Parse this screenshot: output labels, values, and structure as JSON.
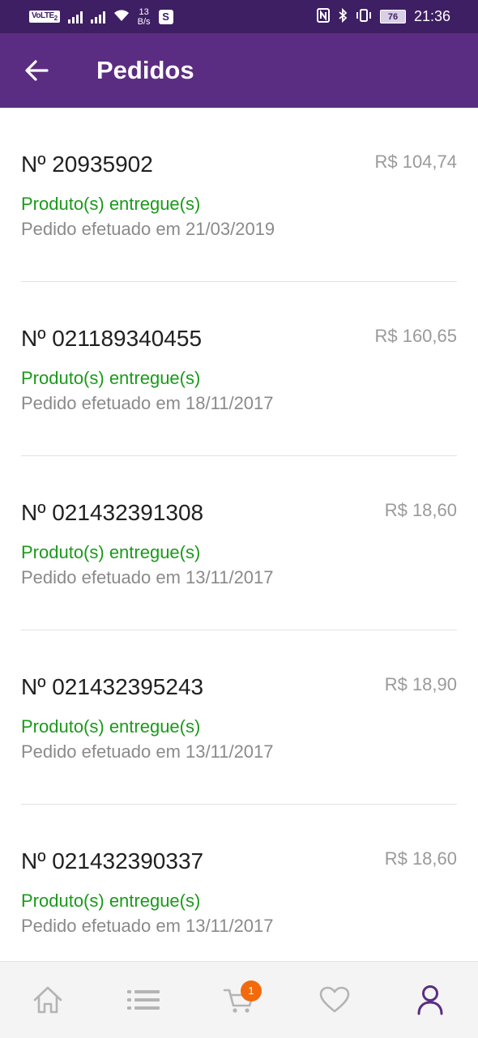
{
  "status_bar": {
    "volte": "VoLTE",
    "volte_sim": "2",
    "net_speed_value": "13",
    "net_speed_unit": "B/s",
    "app_badge": "S",
    "battery": "76",
    "time": "21:36"
  },
  "header": {
    "title": "Pedidos"
  },
  "orders": [
    {
      "number": "Nº 20935902",
      "price": "R$ 104,74",
      "status": "Produto(s) entregue(s)",
      "date": "Pedido efetuado em 21/03/2019"
    },
    {
      "number": "Nº 021189340455",
      "price": "R$ 160,65",
      "status": "Produto(s) entregue(s)",
      "date": "Pedido efetuado em 18/11/2017"
    },
    {
      "number": "Nº 021432391308",
      "price": "R$ 18,60",
      "status": "Produto(s) entregue(s)",
      "date": "Pedido efetuado em 13/11/2017"
    },
    {
      "number": "Nº 021432395243",
      "price": "R$ 18,90",
      "status": "Produto(s) entregue(s)",
      "date": "Pedido efetuado em 13/11/2017"
    },
    {
      "number": "Nº 021432390337",
      "price": "R$ 18,60",
      "status": "Produto(s) entregue(s)",
      "date": "Pedido efetuado em 13/11/2017"
    }
  ],
  "bottom_nav": {
    "items": [
      {
        "icon": "home-icon"
      },
      {
        "icon": "list-icon"
      },
      {
        "icon": "cart-icon",
        "badge": "1"
      },
      {
        "icon": "heart-icon"
      },
      {
        "icon": "user-icon",
        "active": true
      }
    ]
  },
  "colors": {
    "app_bar": "#5b2d82",
    "status_bar": "#3e1f63",
    "status_text": "#1a9a1a",
    "badge": "#f26a0c",
    "active_nav": "#5b2d82"
  }
}
